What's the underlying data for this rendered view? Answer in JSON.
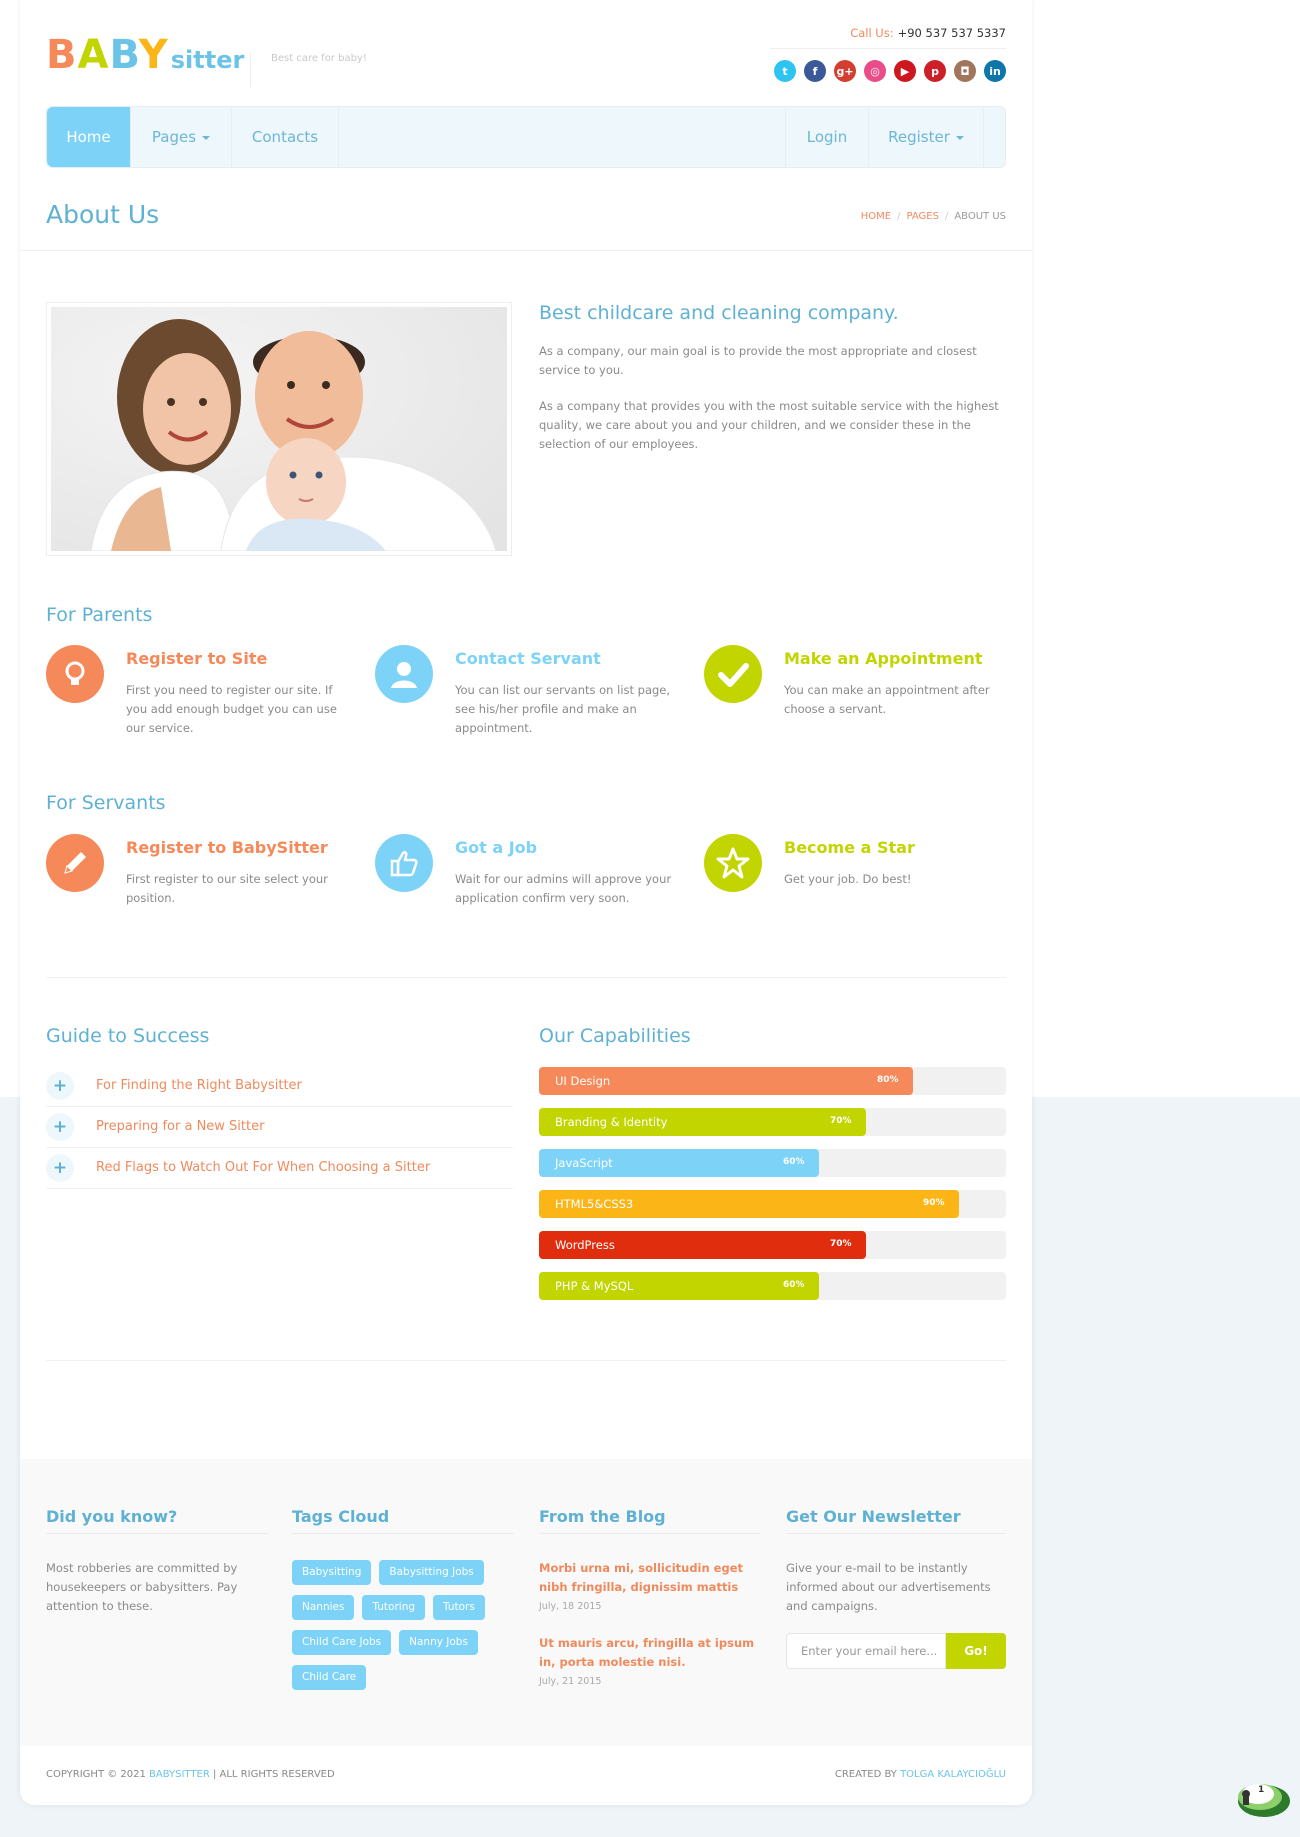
{
  "header": {
    "logo_main": "BABY",
    "logo_sub": "sitter",
    "tagline": "Best care for baby!",
    "call_label": "Call Us:",
    "call_number": "+90 537 537 5337",
    "socials": [
      {
        "name": "twitter-icon",
        "glyph": "t",
        "color": "#2ec4f1"
      },
      {
        "name": "facebook-icon",
        "glyph": "f",
        "color": "#3b5998"
      },
      {
        "name": "google-plus-icon",
        "glyph": "g+",
        "color": "#d23f31"
      },
      {
        "name": "dribbble-icon",
        "glyph": "◎",
        "color": "#ea4c89"
      },
      {
        "name": "youtube-icon",
        "glyph": "▶",
        "color": "#cc181e"
      },
      {
        "name": "pinterest-icon",
        "glyph": "p",
        "color": "#cb2027"
      },
      {
        "name": "instagram-icon",
        "glyph": "◘",
        "color": "#a1755c"
      },
      {
        "name": "linkedin-icon",
        "glyph": "in",
        "color": "#0e76a8"
      }
    ]
  },
  "nav": {
    "home": "Home",
    "pages": "Pages",
    "contacts": "Contacts",
    "login": "Login",
    "register": "Register"
  },
  "page": {
    "title": "About Us",
    "crumb_home": "HOME",
    "crumb_pages": "PAGES",
    "crumb_current": "ABOUT US"
  },
  "about": {
    "heading": "Best childcare and cleaning company.",
    "p1": "As a company, our main goal is to provide the most appropriate and closest service to you.",
    "p2": "As a company that provides you with the most suitable service with the highest quality, we care about you and your children, and we consider these in the selection of our employees."
  },
  "parents": {
    "heading": "For Parents",
    "items": [
      {
        "title": "Register to Site",
        "text": "First you need to register our site. If you add enough budget you can use our service.",
        "color": "#f6895a",
        "icon": "lightbulb-icon"
      },
      {
        "title": "Contact Servant",
        "text": "You can list our servants on list page, see his/her profile and make an appointment.",
        "color": "#7dd3f7",
        "icon": "user-icon"
      },
      {
        "title": "Make an Appointment",
        "text": "You can make an appointment after choose a servant.",
        "color": "#c2d500",
        "icon": "checkmark-icon"
      }
    ]
  },
  "servants": {
    "heading": "For Servants",
    "items": [
      {
        "title": "Register to BabySitter",
        "text": "First register to our site select your position.",
        "color": "#f6895a",
        "icon": "pencil-icon"
      },
      {
        "title": "Got a Job",
        "text": "Wait for our admins will approve your application confirm very soon.",
        "color": "#7dd3f7",
        "icon": "thumbs-up-icon"
      },
      {
        "title": "Become a Star",
        "text": "Get your job. Do best!",
        "color": "#c2d500",
        "icon": "star-icon"
      }
    ]
  },
  "guide": {
    "heading": "Guide to Success",
    "items": [
      "For Finding the Right Babysitter",
      "Preparing for a New Sitter",
      "Red Flags to Watch Out For When Choosing a Sitter"
    ]
  },
  "capabilities": {
    "heading": "Our Capabilities",
    "bars": [
      {
        "label": "UI Design",
        "percent": 80,
        "percent_text": "80%",
        "color": "#f6895a"
      },
      {
        "label": "Branding & Identity",
        "percent": 70,
        "percent_text": "70%",
        "color": "#c2d500"
      },
      {
        "label": "JavaScript",
        "percent": 60,
        "percent_text": "60%",
        "color": "#7dd3f7"
      },
      {
        "label": "HTML5&CSS3",
        "percent": 90,
        "percent_text": "90%",
        "color": "#fbb516"
      },
      {
        "label": "WordPress",
        "percent": 70,
        "percent_text": "70%",
        "color": "#e02d0d"
      },
      {
        "label": "PHP & MySQL",
        "percent": 60,
        "percent_text": "60%",
        "color": "#c2d500"
      }
    ]
  },
  "footer": {
    "did_you_know": {
      "heading": "Did you know?",
      "text": "Most robberies are committed by housekeepers or babysitters. Pay attention to these."
    },
    "tags": {
      "heading": "Tags Cloud",
      "items": [
        "Babysitting",
        "Babysitting Jobs",
        "Nannies",
        "Tutoring",
        "Tutors",
        "Child Care Jobs",
        "Nanny Jobs",
        "Child Care"
      ]
    },
    "blog": {
      "heading": "From the Blog",
      "posts": [
        {
          "title": "Morbi urna mi, sollicitudin eget nibh fringilla, dignissim mattis",
          "date": "July, 18 2015"
        },
        {
          "title": "Ut mauris arcu, fringilla at ipsum in, porta molestie nisi.",
          "date": "July, 21 2015"
        }
      ]
    },
    "newsletter": {
      "heading": "Get Our Newsletter",
      "text": "Give your e-mail to be instantly informed about our advertisements and campaigns.",
      "placeholder": "Enter your email here...",
      "button": "Go!"
    },
    "copyright_pre": "COPYRIGHT © 2021",
    "copyright_brand": "BABYSITTER",
    "copyright_post": "|  ALL RIGHTS RESERVED",
    "created_pre": "CREATED BY",
    "created_brand": "TOLGA KALAYCIOĞLU"
  },
  "chat": {
    "badge": "1"
  }
}
